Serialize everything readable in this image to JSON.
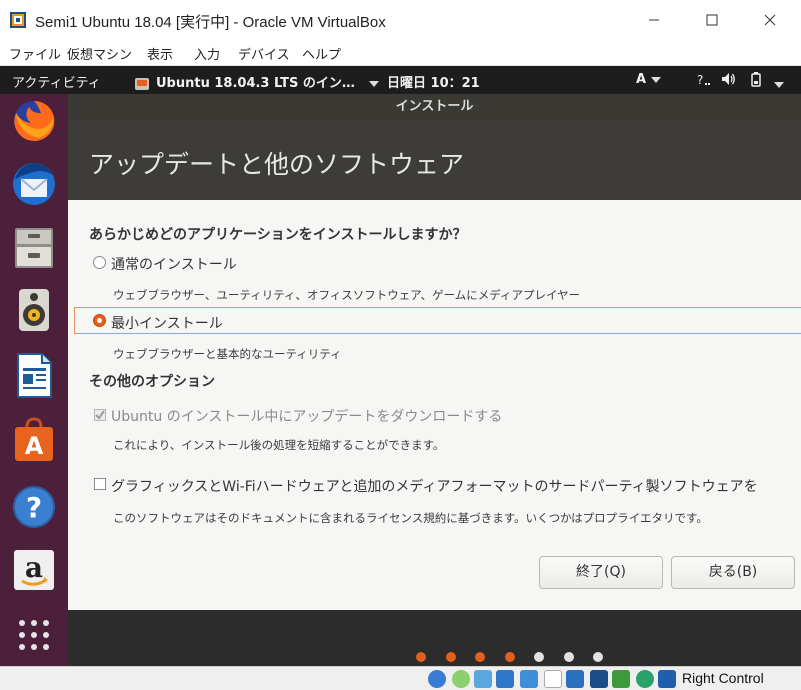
{
  "window": {
    "title": "Semi1 Ubuntu 18.04 [実行中] - Oracle VM VirtualBox"
  },
  "vbox_menu": [
    "ファイル",
    "仮想マシン",
    "表示",
    "入力",
    "デバイス",
    "ヘルプ"
  ],
  "top_panel": {
    "activities": "アクティビティ",
    "app_menu": "Ubuntu 18.04.3 LTS のイン…",
    "clock": "日曜日 10：21",
    "input_method": "A"
  },
  "dock_icons": [
    "firefox-icon",
    "thunderbird-icon",
    "files-icon",
    "rhythmbox-icon",
    "libreoffice-writer-icon",
    "ubuntu-software-icon",
    "help-icon",
    "amazon-icon",
    "show-applications-icon"
  ],
  "installer": {
    "window_title": "インストール",
    "page_title": "アップデートと他のソフトウェア",
    "question": "あらかじめどのアプリケーションをインストールしますか？",
    "normal_label": "通常のインストール",
    "normal_desc": "ウェブブラウザー、ユーティリティ、オフィスソフトウェア、ゲームにメディアプレイヤー",
    "minimal_label": "最小インストール",
    "minimal_desc": "ウェブブラウザーと基本的なユーティリティ",
    "selected_option": "minimal",
    "other_options": "その他のオプション",
    "updates_label": "Ubuntu のインストール中にアップデートをダウンロードする",
    "updates_desc": "これにより、インストール後の処理を短縮することができます。",
    "updates_checked": true,
    "thirdparty_label": "グラフィックスとWi-Fiハードウェアと追加のメディアフォーマットのサードパーティ製ソフトウェアを",
    "thirdparty_desc": "このソフトウェアはそのドキュメントに含まれるライセンス規約に基づきます。いくつかはプロプライエタリです。",
    "thirdparty_checked": false,
    "quit_button": "終了(Q)",
    "back_button": "戻る(B)",
    "progress": {
      "completed_steps": 4,
      "total_steps": 7
    }
  },
  "status_bar": {
    "host_key": "Right Control"
  },
  "colors": {
    "accent": "#e35f1c",
    "dock": "#4c1f3b",
    "banner": "#3d3c38"
  }
}
